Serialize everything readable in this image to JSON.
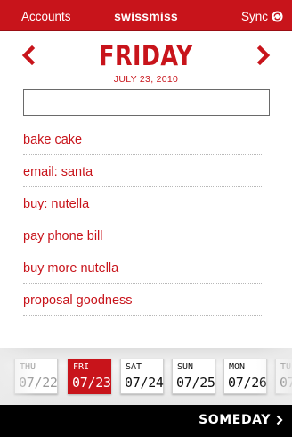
{
  "navbar": {
    "left_label": "Accounts",
    "title": "swissmiss",
    "right_label": "Sync"
  },
  "day": {
    "name": "FRIDAY",
    "date": "JULY 23, 2010"
  },
  "new_task": {
    "value": "",
    "placeholder": ""
  },
  "tasks": [
    {
      "label": "bake cake"
    },
    {
      "label": "email: santa"
    },
    {
      "label": "buy: nutella"
    },
    {
      "label": "pay phone bill"
    },
    {
      "label": "buy more nutella"
    },
    {
      "label": "proposal goodness"
    }
  ],
  "date_strip": [
    {
      "weekday": "THU",
      "date": "07/22",
      "state": "past"
    },
    {
      "weekday": "FRI",
      "date": "07/23",
      "state": "active"
    },
    {
      "weekday": "SAT",
      "date": "07/24",
      "state": "future"
    },
    {
      "weekday": "SUN",
      "date": "07/25",
      "state": "future"
    },
    {
      "weekday": "MON",
      "date": "07/26",
      "state": "future"
    },
    {
      "weekday": "TU",
      "date": "07/",
      "state": "future"
    }
  ],
  "bottom_bar": {
    "someday_label": "SOMEDAY"
  },
  "colors": {
    "accent": "#c8141b",
    "bottom_bar": "#000000"
  },
  "icons": {
    "sync": "sync-icon",
    "prev": "chevron-left-icon",
    "next": "chevron-right-icon",
    "someday": "chevron-right-icon"
  }
}
